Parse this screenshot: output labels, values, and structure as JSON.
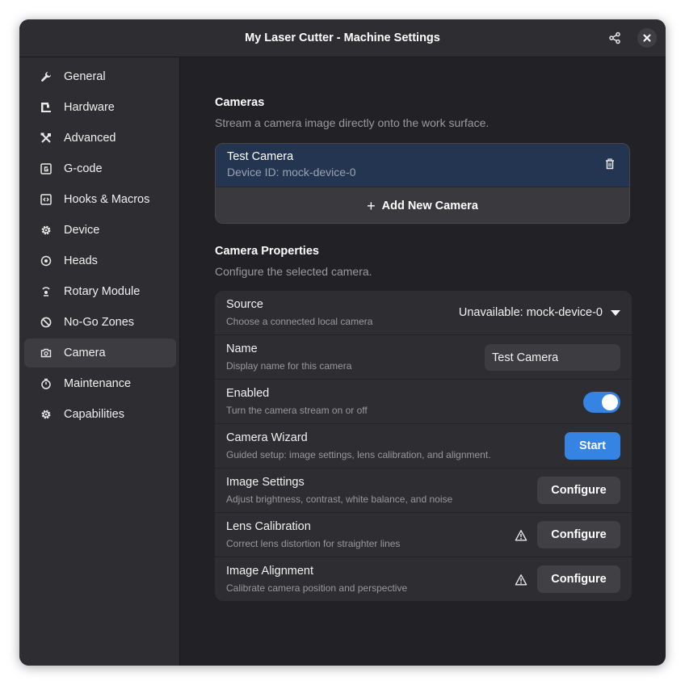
{
  "window": {
    "title": "My Laser Cutter - Machine Settings"
  },
  "sidebar": {
    "items": [
      {
        "label": "General",
        "icon": "wrench-icon",
        "active": false
      },
      {
        "label": "Hardware",
        "icon": "laser-icon",
        "active": false
      },
      {
        "label": "Advanced",
        "icon": "tools-icon",
        "active": false
      },
      {
        "label": "G-code",
        "icon": "gcode-icon",
        "active": false
      },
      {
        "label": "Hooks & Macros",
        "icon": "code-icon",
        "active": false
      },
      {
        "label": "Device",
        "icon": "gear-icon",
        "active": false
      },
      {
        "label": "Heads",
        "icon": "target-icon",
        "active": false
      },
      {
        "label": "Rotary Module",
        "icon": "rotary-icon",
        "active": false
      },
      {
        "label": "No-Go Zones",
        "icon": "prohibited-icon",
        "active": false
      },
      {
        "label": "Camera",
        "icon": "camera-icon",
        "active": true
      },
      {
        "label": "Maintenance",
        "icon": "stopwatch-icon",
        "active": false
      },
      {
        "label": "Capabilities",
        "icon": "gear-icon",
        "active": false
      }
    ]
  },
  "cameras": {
    "title": "Cameras",
    "subtitle": "Stream a camera image directly onto the work surface.",
    "list": [
      {
        "name": "Test Camera",
        "device": "Device ID: mock-device-0"
      }
    ],
    "add_label": "Add New Camera"
  },
  "properties": {
    "title": "Camera Properties",
    "subtitle": "Configure the selected camera.",
    "source": {
      "label": "Source",
      "desc": "Choose a connected local camera",
      "value": "Unavailable: mock-device-0"
    },
    "name": {
      "label": "Name",
      "desc": "Display name for this camera",
      "value": "Test Camera"
    },
    "enabled": {
      "label": "Enabled",
      "desc": "Turn the camera stream on or off",
      "on": true
    },
    "wizard": {
      "label": "Camera Wizard",
      "desc": "Guided setup: image settings, lens calibration, and alignment.",
      "button": "Start"
    },
    "image_settings": {
      "label": "Image Settings",
      "desc": "Adjust brightness, contrast, white balance, and noise",
      "button": "Configure"
    },
    "lens": {
      "label": "Lens Calibration",
      "desc": "Correct lens distortion for straighter lines",
      "button": "Configure",
      "warning": true
    },
    "alignment": {
      "label": "Image Alignment",
      "desc": "Calibrate camera position and perspective",
      "button": "Configure",
      "warning": true
    }
  },
  "colors": {
    "accent": "#3584e4",
    "window_bg": "#222226",
    "sidebar_bg": "#2e2e32",
    "selected_camera_bg": "#233551"
  }
}
